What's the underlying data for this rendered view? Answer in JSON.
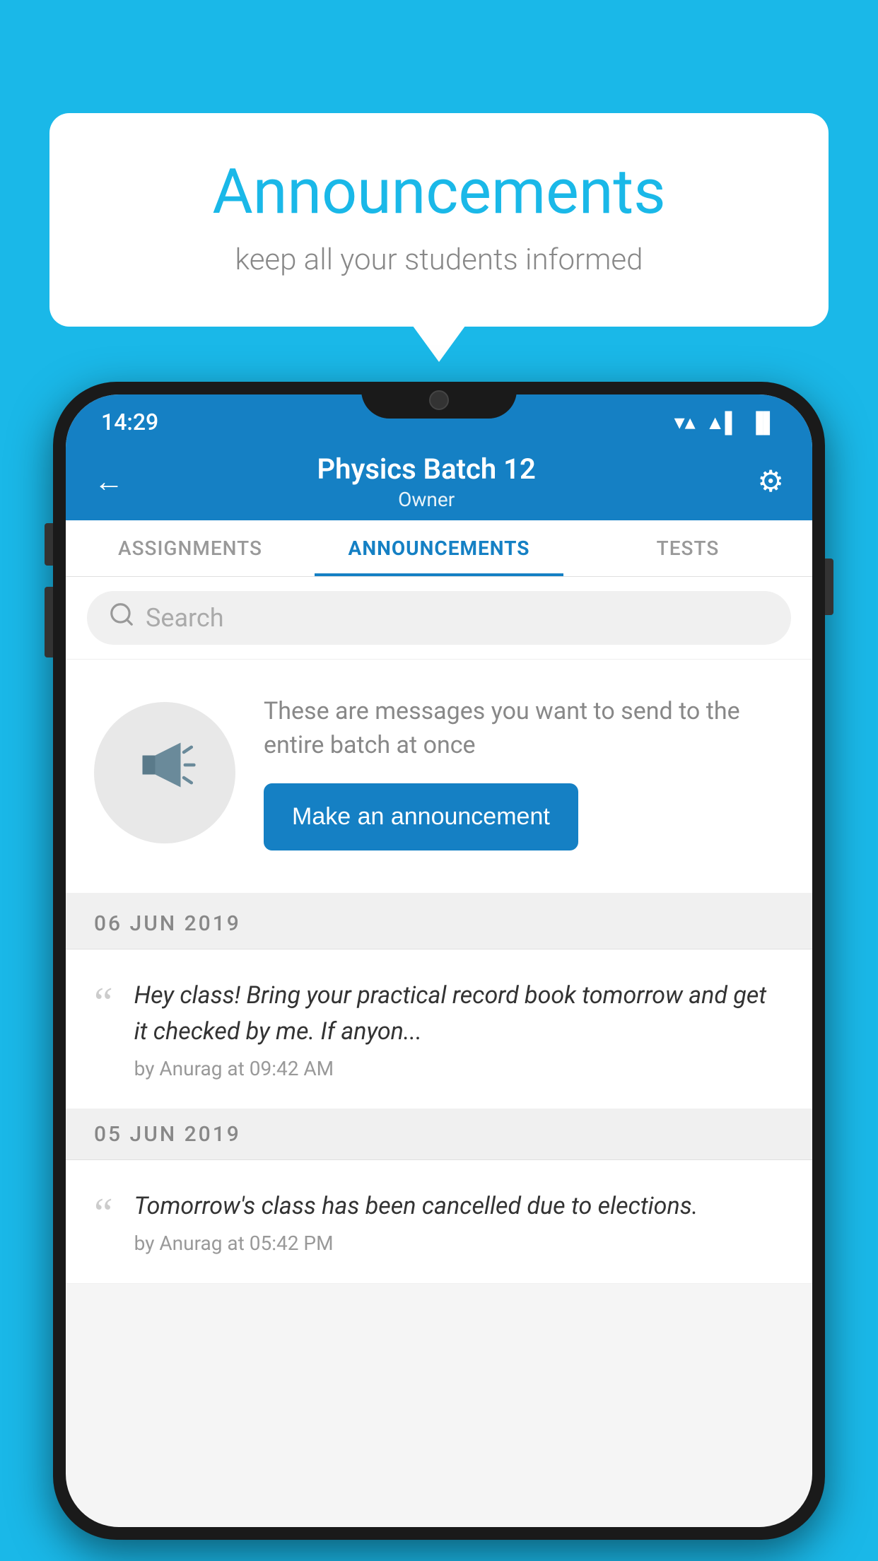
{
  "background_color": "#1ab8e8",
  "speech_bubble": {
    "title": "Announcements",
    "subtitle": "keep all your students informed"
  },
  "phone": {
    "status_bar": {
      "time": "14:29",
      "wifi": "▼",
      "signal": "▲",
      "battery": "▐"
    },
    "app_bar": {
      "back_label": "←",
      "title": "Physics Batch 12",
      "subtitle": "Owner",
      "settings_label": "⚙"
    },
    "tabs": [
      {
        "label": "ASSIGNMENTS",
        "active": false
      },
      {
        "label": "ANNOUNCEMENTS",
        "active": true
      },
      {
        "label": "TESTS",
        "active": false
      }
    ],
    "search": {
      "placeholder": "Search"
    },
    "announcement_prompt": {
      "description": "These are messages you want to send to the entire batch at once",
      "button_label": "Make an announcement"
    },
    "announcements": [
      {
        "date": "06  JUN  2019",
        "message": "Hey class! Bring your practical record book tomorrow and get it checked by me. If anyon...",
        "author": "by Anurag at 09:42 AM"
      },
      {
        "date": "05  JUN  2019",
        "message": "Tomorrow's class has been cancelled due to elections.",
        "author": "by Anurag at 05:42 PM"
      }
    ]
  }
}
